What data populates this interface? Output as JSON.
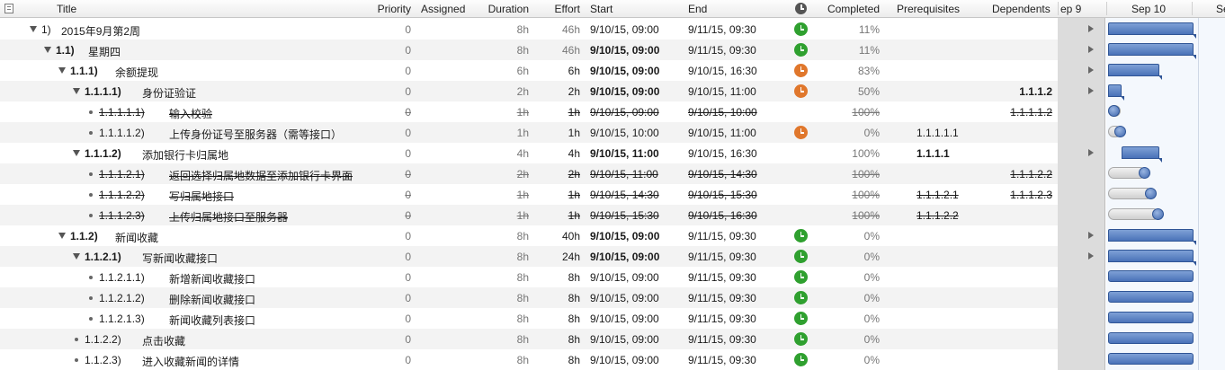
{
  "header": {
    "title": "Title",
    "priority": "Priority",
    "assigned": "Assigned",
    "duration": "Duration",
    "effort": "Effort",
    "start": "Start",
    "end": "End",
    "completed": "Completed",
    "prerequisites": "Prerequisites",
    "dependents": "Dependents",
    "gantt_dates": [
      "ep 9",
      "Sep 10",
      "Se"
    ]
  },
  "status_colors": {
    "green": "#2fa02f",
    "orange": "#e0772c"
  },
  "rows": [
    {
      "id": "1)",
      "title": "2015年9月第2周",
      "level": 0,
      "type": "group",
      "priority": "0",
      "assigned": "",
      "duration": "8h",
      "effort": "46h",
      "start": "9/10/15, 09:00",
      "end": "9/11/15, 09:30",
      "status": "green",
      "completed": "11%",
      "prerequisites": "",
      "dependents": "",
      "done": false,
      "bold": false
    },
    {
      "id": "1.1)",
      "title": "星期四",
      "level": 1,
      "type": "group",
      "priority": "0",
      "assigned": "",
      "duration": "8h",
      "effort": "46h",
      "start": "9/10/15, 09:00",
      "end": "9/11/15, 09:30",
      "status": "green",
      "completed": "11%",
      "prerequisites": "",
      "dependents": "",
      "done": false,
      "bold": true
    },
    {
      "id": "1.1.1)",
      "title": "余额提现",
      "level": 2,
      "type": "group",
      "priority": "0",
      "assigned": "",
      "duration": "6h",
      "effort": "6h",
      "start": "9/10/15, 09:00",
      "end": "9/10/15, 16:30",
      "status": "orange",
      "completed": "83%",
      "prerequisites": "",
      "dependents": "",
      "done": false,
      "bold": true
    },
    {
      "id": "1.1.1.1)",
      "title": "身份证验证",
      "level": 3,
      "type": "group",
      "priority": "0",
      "assigned": "",
      "duration": "2h",
      "effort": "2h",
      "start": "9/10/15, 09:00",
      "end": "9/10/15, 11:00",
      "status": "orange",
      "completed": "50%",
      "prerequisites": "",
      "dependents": "1.1.1.2",
      "done": false,
      "bold": true
    },
    {
      "id": "1.1.1.1.1)",
      "title": "输入校验",
      "level": 4,
      "type": "task",
      "priority": "0",
      "assigned": "",
      "duration": "1h",
      "effort": "1h",
      "start": "9/10/15, 09:00",
      "end": "9/10/15, 10:00",
      "status": "",
      "completed": "100%",
      "prerequisites": "",
      "dependents": "1.1.1.1.2",
      "done": true,
      "bold": false
    },
    {
      "id": "1.1.1.1.2)",
      "title": "上传身份证号至服务器（需等接口）",
      "level": 4,
      "type": "task",
      "priority": "0",
      "assigned": "",
      "duration": "1h",
      "effort": "1h",
      "start": "9/10/15, 10:00",
      "end": "9/10/15, 11:00",
      "status": "orange",
      "completed": "0%",
      "prerequisites": "1.1.1.1.1",
      "dependents": "",
      "done": false,
      "bold": false
    },
    {
      "id": "1.1.1.2)",
      "title": "添加银行卡归属地",
      "level": 3,
      "type": "group",
      "priority": "0",
      "assigned": "",
      "duration": "4h",
      "effort": "4h",
      "start": "9/10/15, 11:00",
      "end": "9/10/15, 16:30",
      "status": "",
      "completed": "100%",
      "prerequisites": "1.1.1.1",
      "dependents": "",
      "done": false,
      "bold": true
    },
    {
      "id": "1.1.1.2.1)",
      "title": "返回选择归属地数据至添加银行卡界面",
      "level": 4,
      "type": "task",
      "priority": "0",
      "assigned": "",
      "duration": "2h",
      "effort": "2h",
      "start": "9/10/15, 11:00",
      "end": "9/10/15, 14:30",
      "status": "",
      "completed": "100%",
      "prerequisites": "",
      "dependents": "1.1.1.2.2",
      "done": true,
      "bold": false
    },
    {
      "id": "1.1.1.2.2)",
      "title": "写归属地接口",
      "level": 4,
      "type": "task",
      "priority": "0",
      "assigned": "",
      "duration": "1h",
      "effort": "1h",
      "start": "9/10/15, 14:30",
      "end": "9/10/15, 15:30",
      "status": "",
      "completed": "100%",
      "prerequisites": "1.1.1.2.1",
      "dependents": "1.1.1.2.3",
      "done": true,
      "bold": false
    },
    {
      "id": "1.1.1.2.3)",
      "title": "上传归属地接口至服务器",
      "level": 4,
      "type": "task",
      "priority": "0",
      "assigned": "",
      "duration": "1h",
      "effort": "1h",
      "start": "9/10/15, 15:30",
      "end": "9/10/15, 16:30",
      "status": "",
      "completed": "100%",
      "prerequisites": "1.1.1.2.2",
      "dependents": "",
      "done": true,
      "bold": false
    },
    {
      "id": "1.1.2)",
      "title": "新闻收藏",
      "level": 2,
      "type": "group",
      "priority": "0",
      "assigned": "",
      "duration": "8h",
      "effort": "40h",
      "start": "9/10/15, 09:00",
      "end": "9/11/15, 09:30",
      "status": "green",
      "completed": "0%",
      "prerequisites": "",
      "dependents": "",
      "done": false,
      "bold": true
    },
    {
      "id": "1.1.2.1)",
      "title": "写新闻收藏接口",
      "level": 3,
      "type": "group",
      "priority": "0",
      "assigned": "",
      "duration": "8h",
      "effort": "24h",
      "start": "9/10/15, 09:00",
      "end": "9/11/15, 09:30",
      "status": "green",
      "completed": "0%",
      "prerequisites": "",
      "dependents": "",
      "done": false,
      "bold": true
    },
    {
      "id": "1.1.2.1.1)",
      "title": "新增新闻收藏接口",
      "level": 4,
      "type": "task",
      "priority": "0",
      "assigned": "",
      "duration": "8h",
      "effort": "8h",
      "start": "9/10/15, 09:00",
      "end": "9/11/15, 09:30",
      "status": "green",
      "completed": "0%",
      "prerequisites": "",
      "dependents": "",
      "done": false,
      "bold": false
    },
    {
      "id": "1.1.2.1.2)",
      "title": "删除新闻收藏接口",
      "level": 4,
      "type": "task",
      "priority": "0",
      "assigned": "",
      "duration": "8h",
      "effort": "8h",
      "start": "9/10/15, 09:00",
      "end": "9/11/15, 09:30",
      "status": "green",
      "completed": "0%",
      "prerequisites": "",
      "dependents": "",
      "done": false,
      "bold": false
    },
    {
      "id": "1.1.2.1.3)",
      "title": "新闻收藏列表接口",
      "level": 4,
      "type": "task",
      "priority": "0",
      "assigned": "",
      "duration": "8h",
      "effort": "8h",
      "start": "9/10/15, 09:00",
      "end": "9/11/15, 09:30",
      "status": "green",
      "completed": "0%",
      "prerequisites": "",
      "dependents": "",
      "done": false,
      "bold": false
    },
    {
      "id": "1.1.2.2)",
      "title": "点击收藏",
      "level": 3,
      "type": "task",
      "priority": "0",
      "assigned": "",
      "duration": "8h",
      "effort": "8h",
      "start": "9/10/15, 09:00",
      "end": "9/11/15, 09:30",
      "status": "green",
      "completed": "0%",
      "prerequisites": "",
      "dependents": "",
      "done": false,
      "bold": false
    },
    {
      "id": "1.1.2.3)",
      "title": "进入收藏新闻的详情",
      "level": 3,
      "type": "task",
      "priority": "0",
      "assigned": "",
      "duration": "8h",
      "effort": "8h",
      "start": "9/10/15, 09:00",
      "end": "9/11/15, 09:30",
      "status": "green",
      "completed": "0%",
      "prerequisites": "",
      "dependents": "",
      "done": false,
      "bold": false
    }
  ]
}
